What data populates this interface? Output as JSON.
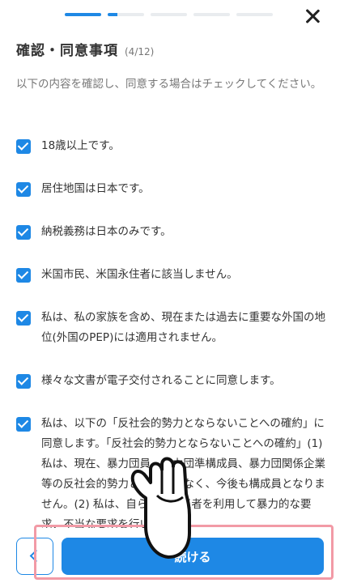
{
  "progress": {
    "current": 4,
    "total": 12,
    "accent": "#1e88e5"
  },
  "header": {
    "title": "確認・同意事項",
    "step_count": "(4/12)"
  },
  "description": "以下の内容を確認し、同意する場合はチェックしてください。",
  "items": [
    {
      "label": "18歳以上です。",
      "checked": true
    },
    {
      "label": "居住地国は日本です。",
      "checked": true
    },
    {
      "label": "納税義務は日本のみです。",
      "checked": true
    },
    {
      "label": "米国市民、米国永住者に該当しません。",
      "checked": true
    },
    {
      "label": "私は、私の家族を含め、現在または過去に重要な外国の地位(外国のPEP)には適用されません。",
      "checked": true
    },
    {
      "label": "様々な文書が電子交付されることに同意します。",
      "checked": true
    },
    {
      "label": "私は、以下の「反社会的勢力とならないことへの確約」に同意します。「反社会的勢力とならないことへの確約」(1) 私は、現在、暴力団員、暴力団準構成員、暴力団関係企業等の反社会的勢力とは関係がなく、今後も構成員となりません。(2) 私は、自ら又は第三者を利用して暴力的な要求、不当な要求を行いません。",
      "checked": true
    }
  ],
  "footer": {
    "back_icon": "chevron-left-icon",
    "next_label": "続ける"
  },
  "overlay": {
    "highlight_color": "#f29aa6",
    "pointer_icon": "pointing-hand-icon"
  }
}
